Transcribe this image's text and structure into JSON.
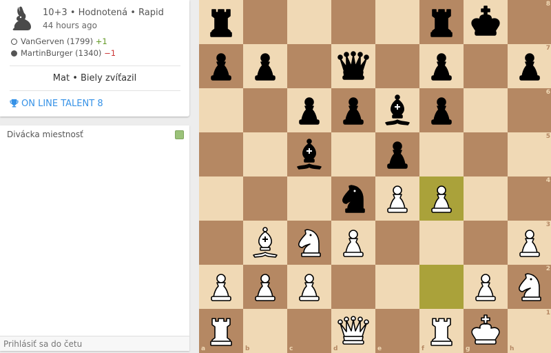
{
  "game": {
    "time_control": "10+3 • Hodnotená • Rapid",
    "time_ago": "44 hours ago",
    "white_player": {
      "name": "VanGerven (1799)",
      "diff": "+1"
    },
    "black_player": {
      "name": "MartinBurger (1340)",
      "diff": "−1"
    },
    "status": "Mat • Biely zvíťazil",
    "tournament": "ON LINE TALENT 8",
    "speed_icon": "rabbit-icon",
    "tournament_icon": "trophy-icon"
  },
  "chat": {
    "title": "Divácka miestnosť",
    "input_placeholder": "Prihlásiť sa do četu"
  },
  "colors": {
    "light_square": "#f0d9b5",
    "dark_square": "#b58863",
    "last_move_highlight": "#aaa23a",
    "tournament_link": "#3692e7",
    "rating_gain": "#629924",
    "rating_loss": "#cc3333"
  },
  "board": {
    "files": [
      "a",
      "b",
      "c",
      "d",
      "e",
      "f",
      "g",
      "h"
    ],
    "ranks": [
      "8",
      "7",
      "6",
      "5",
      "4",
      "3",
      "2",
      "1"
    ],
    "pieces": [
      {
        "square": "a8",
        "piece": "r"
      },
      {
        "square": "f8",
        "piece": "r"
      },
      {
        "square": "g8",
        "piece": "k"
      },
      {
        "square": "a7",
        "piece": "p"
      },
      {
        "square": "b7",
        "piece": "p"
      },
      {
        "square": "d7",
        "piece": "q"
      },
      {
        "square": "f7",
        "piece": "p"
      },
      {
        "square": "h7",
        "piece": "p"
      },
      {
        "square": "c6",
        "piece": "p"
      },
      {
        "square": "d6",
        "piece": "p"
      },
      {
        "square": "e6",
        "piece": "b"
      },
      {
        "square": "f6",
        "piece": "p"
      },
      {
        "square": "c5",
        "piece": "b"
      },
      {
        "square": "e5",
        "piece": "p"
      },
      {
        "square": "d4",
        "piece": "n"
      },
      {
        "square": "e4",
        "piece": "P"
      },
      {
        "square": "f4",
        "piece": "P"
      },
      {
        "square": "b3",
        "piece": "B"
      },
      {
        "square": "c3",
        "piece": "N"
      },
      {
        "square": "d3",
        "piece": "P"
      },
      {
        "square": "h3",
        "piece": "P"
      },
      {
        "square": "a2",
        "piece": "P"
      },
      {
        "square": "b2",
        "piece": "P"
      },
      {
        "square": "c2",
        "piece": "P"
      },
      {
        "square": "g2",
        "piece": "P"
      },
      {
        "square": "h2",
        "piece": "N"
      },
      {
        "square": "a1",
        "piece": "R"
      },
      {
        "square": "d1",
        "piece": "Q"
      },
      {
        "square": "f1",
        "piece": "R"
      },
      {
        "square": "g1",
        "piece": "K"
      }
    ],
    "last_move": [
      "f2",
      "f4"
    ]
  }
}
